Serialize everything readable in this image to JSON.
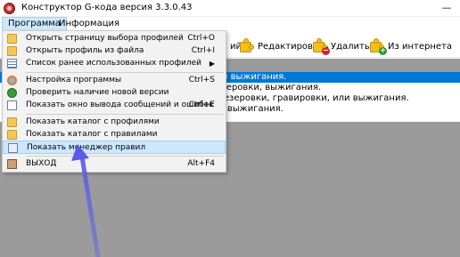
{
  "window": {
    "title": "Конструктор G-кода версия 3.3.0.43",
    "minimize_glyph": "—"
  },
  "menubar": {
    "items": [
      "Программа",
      "Информация"
    ]
  },
  "toolbar": {
    "partial_label": "ийл",
    "edit_label": "Редактировать",
    "delete_label": "Удалить",
    "internet_label": "Из интернета"
  },
  "list": {
    "rows": [
      "или выжигания.",
      "резеровки, выжигания.",
      "фрезеровки, гравировки, или выжигания.",
      "ки, выжигания."
    ]
  },
  "dropdown": {
    "items": [
      {
        "label": "Открыть страницу выбора профилей",
        "shortcut": "Ctrl+O",
        "icon": "folder-star-icon"
      },
      {
        "label": "Открыть профиль из файла",
        "shortcut": "Ctrl+I",
        "icon": "folder-open-icon"
      },
      {
        "label": "Список ранее использованных профилей",
        "shortcut": "",
        "icon": "list-icon",
        "submenu": true
      },
      {
        "label": "Настройка программы",
        "shortcut": "Ctrl+S",
        "icon": "settings-icon"
      },
      {
        "label": "Проверить наличие новой версии",
        "shortcut": "",
        "icon": "update-icon"
      },
      {
        "label": "Показать окно вывода сообщений и ошибок",
        "shortcut": "Ctrl+E",
        "icon": "messages-icon"
      },
      {
        "label": "Показать каталог с профилями",
        "shortcut": "",
        "icon": "folder-icon"
      },
      {
        "label": "Показать каталог с правилами",
        "shortcut": "",
        "icon": "folder-icon"
      },
      {
        "label": "Показать менеджер правил",
        "shortcut": "",
        "icon": "rules-manager-icon",
        "highlighted": true
      },
      {
        "label": "ВЫХОД",
        "shortcut": "Alt+F4",
        "icon": "exit-icon"
      }
    ],
    "submenu_arrow": "▶"
  },
  "colors": {
    "selection_blue": "#0078d7",
    "menu_highlight": "#cce8ff",
    "annotation_arrow": "#8080e8"
  }
}
